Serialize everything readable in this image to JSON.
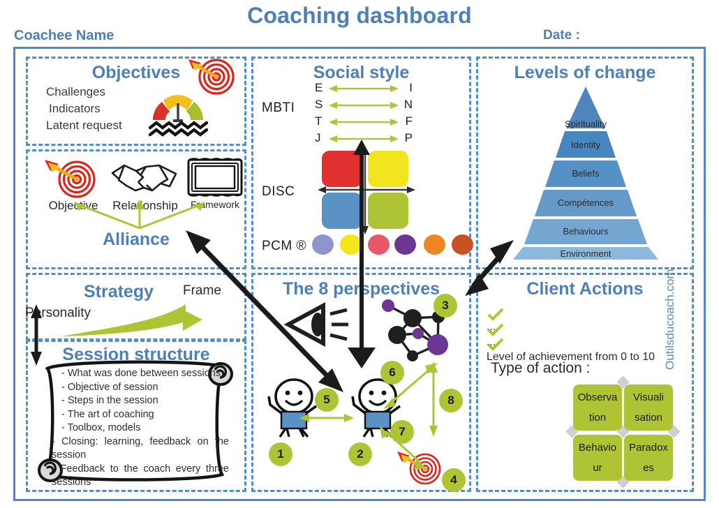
{
  "header": {
    "title": "Coaching dashboard",
    "coachee_label": "Coachee Name",
    "date_label": "Date :",
    "accent_color": "#4E80B8"
  },
  "watermark": "Outilsducoach.com",
  "panels": {
    "objectives": {
      "title": "Objectives",
      "lines": [
        "Challenges",
        "Indicators",
        "Latent request"
      ],
      "icons": [
        "target-icon",
        "gauge-icon"
      ]
    },
    "alliance": {
      "title": "Alliance",
      "items": [
        {
          "label": "Objective",
          "icon": "target-icon"
        },
        {
          "label": "Relationship",
          "icon": "handshake-icon"
        },
        {
          "label": "Framework",
          "icon": "picture-frame-icon"
        }
      ]
    },
    "strategy": {
      "title": "Strategy",
      "frame_label": "Frame",
      "personality_label": "Personality"
    },
    "session": {
      "title": "Session structure",
      "lines": [
        "- What was done between sessions",
        "- Objective of session",
        "- Steps in the session",
        "- The art of coaching",
        "- Toolbox, models",
        "- Closing: learning, feedback on the session",
        "- Feedback to the coach every three sessions"
      ]
    },
    "social": {
      "title": "Social style",
      "mbti_label": "MBTI",
      "disc_label": "DISC",
      "pcm_label": "PCM ®",
      "mbti_pairs": [
        {
          "left": "E",
          "right": "I"
        },
        {
          "left": "S",
          "right": "N"
        },
        {
          "left": "T",
          "right": "F"
        },
        {
          "left": "J",
          "right": "P"
        }
      ],
      "disc_colors": [
        "#E03030",
        "#F2E421",
        "#5B92C6",
        "#AFC435"
      ],
      "pcm_colors": [
        "#8F94CF",
        "#F3E71C",
        "#E8576B",
        "#6C3692",
        "#EE8722",
        "#C75222"
      ]
    },
    "levels": {
      "title": "Levels of change",
      "tiers": [
        {
          "label": "Spirituality",
          "color": "#4E86BC"
        },
        {
          "label": "Identity",
          "color": "#4786BE"
        },
        {
          "label": "Beliefs",
          "color": "#5691C5"
        },
        {
          "label": "Compétences",
          "color": "#6499C8"
        },
        {
          "label": "Behaviours",
          "color": "#74A6D1"
        },
        {
          "label": "Environment",
          "color": "#8CB8DC"
        }
      ]
    },
    "perspectives": {
      "title": "The 8 perspectives",
      "badges": [
        "1",
        "2",
        "3",
        "4",
        "5",
        "6",
        "7",
        "8"
      ],
      "badge_color": "#AFC435",
      "icons": [
        "eye-icon",
        "network-icon",
        "target-icon",
        "person-icon",
        "person-icon"
      ]
    },
    "actions": {
      "title": "Client Actions",
      "checks": [
        "...",
        "...",
        "Level of achievement from 0 to 10"
      ],
      "type_label": "Type of action :",
      "boxes": [
        "Observa tion",
        "Visuali sation",
        "Behavio ur",
        "Paradox es"
      ],
      "boxes_display": [
        [
          "Observa",
          "tion"
        ],
        [
          "Visuali",
          "sation"
        ],
        [
          "Behavio",
          "ur"
        ],
        [
          "Paradox",
          "es"
        ]
      ],
      "box_color": "#AFC435"
    }
  }
}
